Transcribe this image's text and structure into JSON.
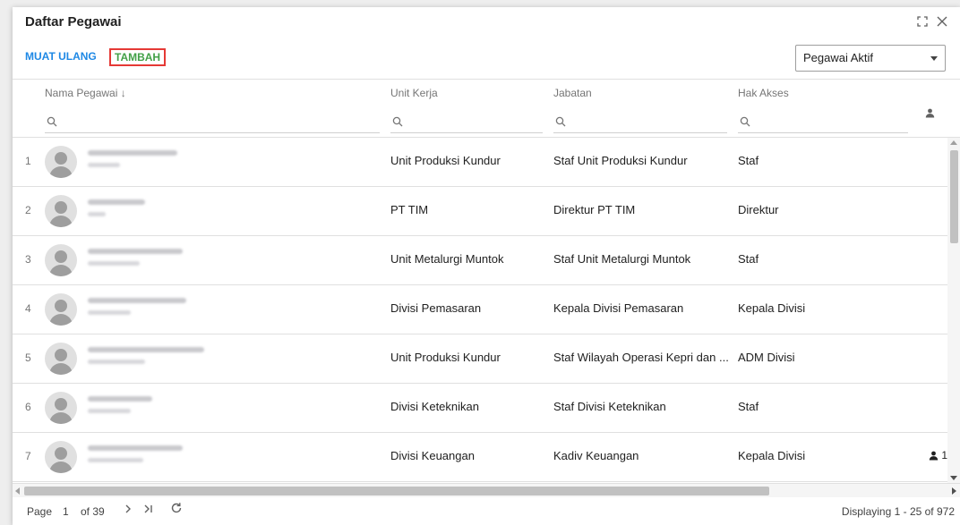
{
  "window": {
    "title": "Daftar Pegawai"
  },
  "toolbar": {
    "reload_label": "MUAT ULANG",
    "add_label": "TAMBAH",
    "filter_value": "Pegawai Aktif"
  },
  "columns": {
    "name": "Nama Pegawai",
    "name_sort": "↓",
    "unit": "Unit Kerja",
    "jabatan": "Jabatan",
    "hak": "Hak Akses"
  },
  "rows": [
    {
      "num": "1",
      "unit": "Unit Produksi Kundur",
      "jabatan": "Staf Unit Produksi Kundur",
      "hak": "Staf",
      "users": ""
    },
    {
      "num": "2",
      "unit": "PT TIM",
      "jabatan": "Direktur PT TIM",
      "hak": "Direktur",
      "users": ""
    },
    {
      "num": "3",
      "unit": "Unit Metalurgi Muntok",
      "jabatan": "Staf Unit Metalurgi Muntok",
      "hak": "Staf",
      "users": ""
    },
    {
      "num": "4",
      "unit": "Divisi Pemasaran",
      "jabatan": "Kepala Divisi Pemasaran",
      "hak": "Kepala Divisi",
      "users": ""
    },
    {
      "num": "5",
      "unit": "Unit Produksi Kundur",
      "jabatan": "Staf Wilayah Operasi Kepri dan ...",
      "hak": "ADM Divisi",
      "users": ""
    },
    {
      "num": "6",
      "unit": "Divisi Keteknikan",
      "jabatan": "Staf Divisi Keteknikan",
      "hak": "Staf",
      "users": ""
    },
    {
      "num": "7",
      "unit": "Divisi Keuangan",
      "jabatan": "Kadiv Keuangan",
      "hak": "Kepala Divisi",
      "users": "1"
    }
  ],
  "pager": {
    "page_label": "Page",
    "page": "1",
    "of_label": "of 39",
    "display": "Displaying 1 - 25 of 972"
  },
  "icons": [
    "maximize-icon",
    "close-icon",
    "search-icon",
    "user-icon",
    "chevron-right-icon",
    "last-page-icon",
    "refresh-icon"
  ],
  "colors": {
    "reload": "#1e88e5",
    "add": "#43a047",
    "add_border": "#e53935"
  }
}
